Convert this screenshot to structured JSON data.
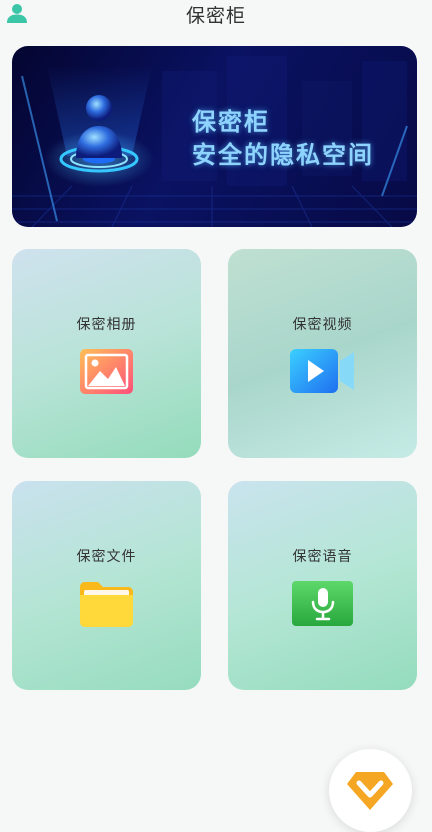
{
  "header": {
    "title": "保密柜",
    "profile_icon": "user-icon"
  },
  "banner": {
    "line1": "保密柜",
    "line2": "安全的隐私空间",
    "accent_color": "#8fd4ff"
  },
  "cards": [
    {
      "label": "保密相册",
      "icon": "photo-icon"
    },
    {
      "label": "保密视频",
      "icon": "video-icon"
    },
    {
      "label": "保密文件",
      "icon": "folder-icon"
    },
    {
      "label": "保密语音",
      "icon": "microphone-icon"
    }
  ],
  "fab": {
    "icon": "vip-diamond-icon",
    "color": "#f5a623"
  }
}
